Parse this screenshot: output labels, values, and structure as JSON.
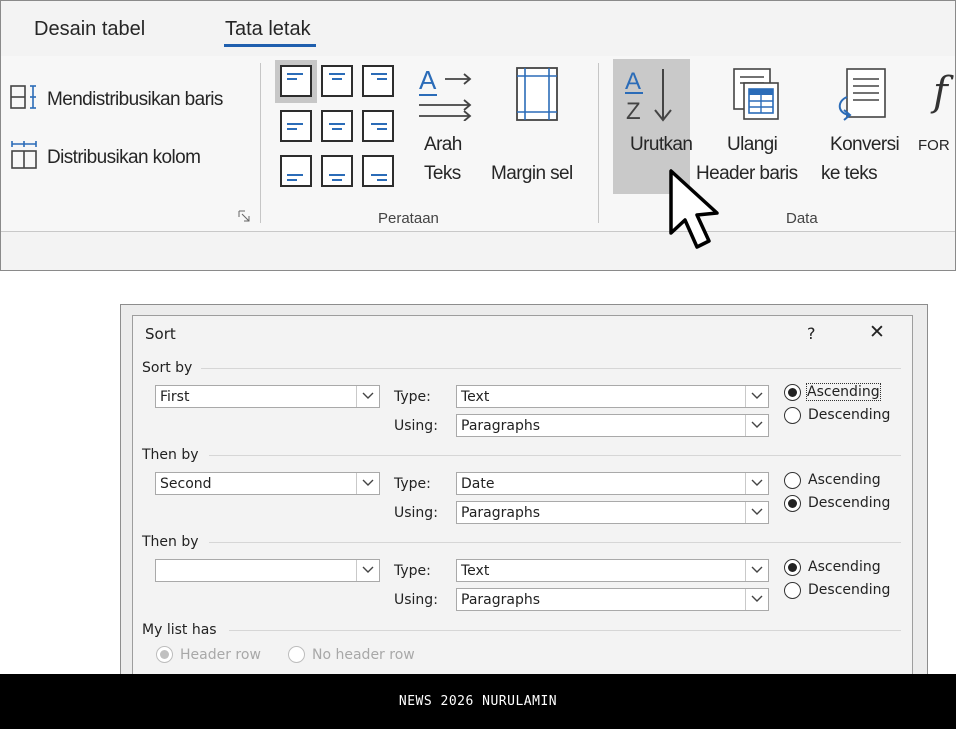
{
  "ribbon": {
    "tabs": [
      {
        "label": "Desain tabel",
        "active": false
      },
      {
        "label": "Tata letak",
        "active": true
      }
    ],
    "distribute_rows_label": "Mendistribusikan baris",
    "distribute_cols_label": "Distribusikan kolom",
    "alignment_group_label": "Perataan",
    "text_direction_label": [
      "Arah",
      "Teks"
    ],
    "cell_margins_label": "Margin sel",
    "sort_label": "Urutkan",
    "repeat_header_label": [
      "Ulangi",
      "Header baris"
    ],
    "convert_label": [
      "Konversi",
      "ke teks"
    ],
    "formula_label": "FOR",
    "data_group_label": "Data",
    "accent_color": "#2b6cb8",
    "tab_underline_color": "#1f5fae"
  },
  "dialog": {
    "title": "Sort",
    "help_label": "?",
    "close_label": "✕",
    "type_label": "Type:",
    "using_label": "Using:",
    "ascending_label": "Ascending",
    "descending_label": "Descending",
    "sort_by": {
      "label": "Sort by",
      "field": "First",
      "type": "Text",
      "using": "Paragraphs",
      "order": "ascending"
    },
    "then_by_1": {
      "label": "Then by",
      "field": "Second",
      "type": "Date",
      "using": "Paragraphs",
      "order": "descending"
    },
    "then_by_2": {
      "label": "Then by",
      "field": "",
      "type": "Text",
      "using": "Paragraphs",
      "order": "ascending"
    },
    "list_has": {
      "label": "My list has",
      "header_row_label": "Header row",
      "no_header_row_label": "No header row",
      "selected": "header_row"
    }
  },
  "banner": {
    "text": "NEWS 2026 NURULAMIN"
  }
}
